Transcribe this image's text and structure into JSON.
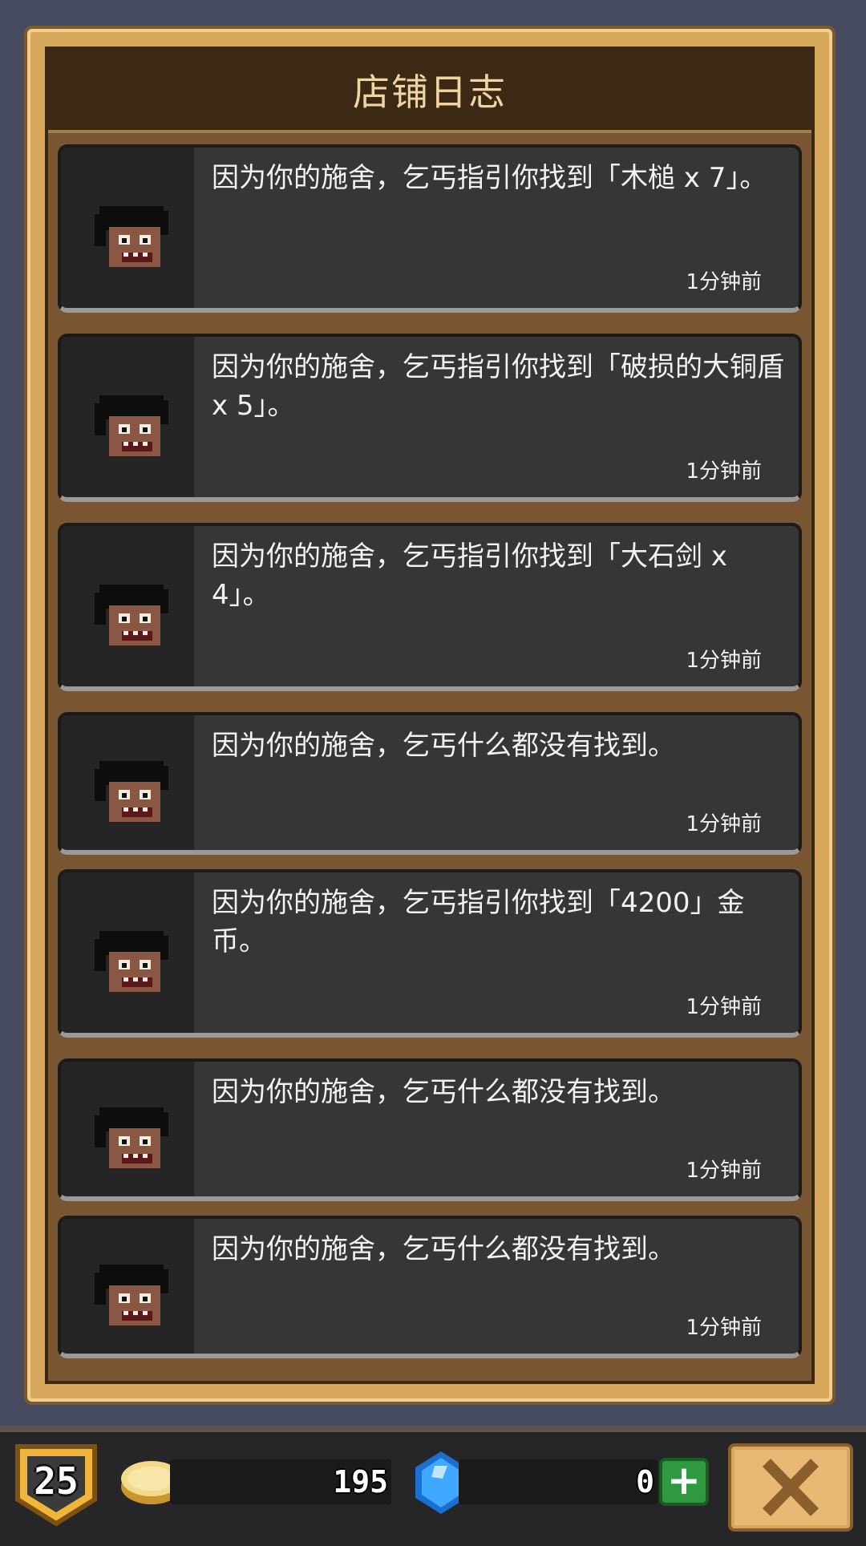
{
  "header": {
    "title": "店铺日志"
  },
  "log_entries": [
    {
      "message": "因为你的施舍，乞丐指引你找到「木槌 x 7」。",
      "time": "1分钟前",
      "avatar": "beggar-avatar"
    },
    {
      "message": "因为你的施舍，乞丐指引你找到「破损的大铜盾 x 5」。",
      "time": "1分钟前",
      "avatar": "beggar-avatar"
    },
    {
      "message": "因为你的施舍，乞丐指引你找到「大石剑 x 4」。",
      "time": "1分钟前",
      "avatar": "beggar-avatar"
    },
    {
      "message": "因为你的施舍，乞丐什么都没有找到。",
      "time": "1分钟前",
      "avatar": "beggar-avatar"
    },
    {
      "message": "因为你的施舍，乞丐指引你找到「4200」金币。",
      "time": "1分钟前",
      "avatar": "beggar-avatar"
    },
    {
      "message": "因为你的施舍，乞丐什么都没有找到。",
      "time": "1分钟前",
      "avatar": "beggar-avatar"
    },
    {
      "message": "因为你的施舍，乞丐什么都没有找到。",
      "time": "1分钟前",
      "avatar": "beggar-avatar"
    }
  ],
  "bottom_bar": {
    "level": "25",
    "coins": "195",
    "gems": "0",
    "coin_icon": "gold-coin-icon",
    "gem_icon": "blue-gem-icon",
    "add_icon": "plus-icon",
    "close_icon": "close-x-icon"
  },
  "colors": {
    "frame_gold": "#d8a85c",
    "header_brown": "#3c2914",
    "card_dark": "#363636",
    "plus_green": "#2f9a3f"
  }
}
